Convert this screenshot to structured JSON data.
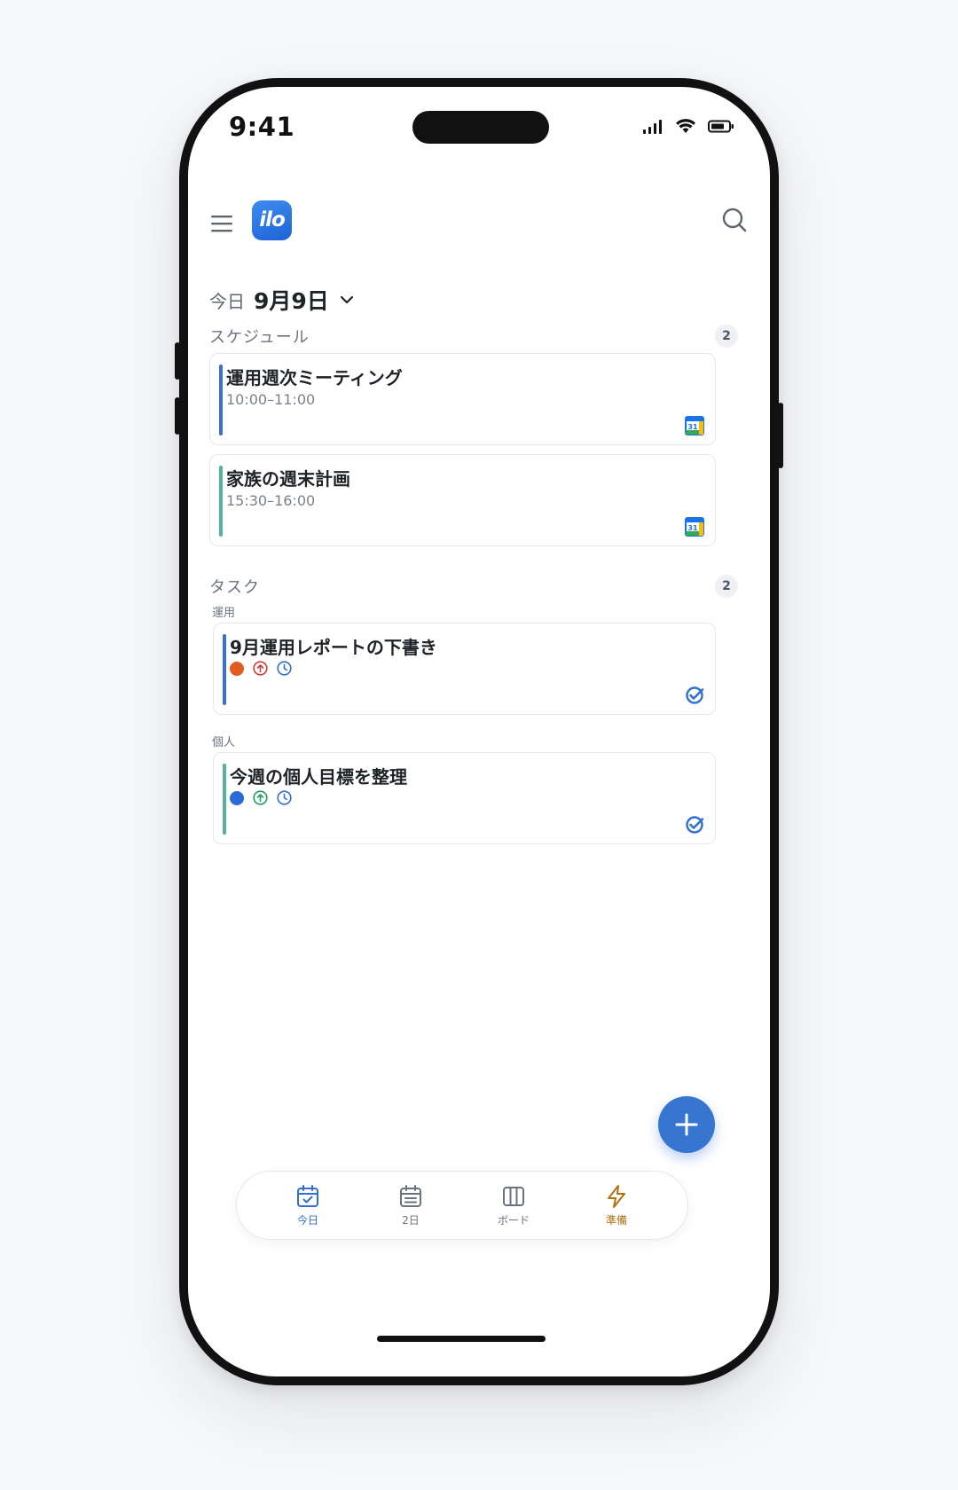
{
  "status_bar": {
    "time": "9:41"
  },
  "header": {
    "logo_text": "ilo"
  },
  "date_selector": {
    "today_label": "今日",
    "date": "9月9日"
  },
  "schedule": {
    "title": "スケジュール",
    "count": "2",
    "events": [
      {
        "title": "運用週次ミーティング",
        "time": "10:00–11:00",
        "color": "#3b6fd4"
      },
      {
        "title": "家族の週末計画",
        "time": "15:30–16:00",
        "color": "#4fb3a0"
      }
    ]
  },
  "tasks": {
    "title": "タスク",
    "count": "2",
    "groups": [
      {
        "label": "運用",
        "task": "9月運用レポートの下書き",
        "color": "#3b6fd4",
        "dot_color": "#e25c1e",
        "priority_color": "#d23a3a"
      },
      {
        "label": "個人",
        "task": "今週の個人目標を整理",
        "color": "#4fb3a0",
        "dot_color": "#2b6bd8",
        "priority_color": "#1f9a5a"
      }
    ]
  },
  "tabs": [
    {
      "label": "今日",
      "icon": "calendar-check-icon",
      "state": "active"
    },
    {
      "label": "2日",
      "icon": "calendar-list-icon",
      "state": "normal"
    },
    {
      "label": "ボード",
      "icon": "board-columns-icon",
      "state": "normal"
    },
    {
      "label": "準備",
      "icon": "lightning-icon",
      "state": "accent"
    }
  ],
  "colors": {
    "accent": "#3676d0",
    "prep": "#b3700f"
  }
}
